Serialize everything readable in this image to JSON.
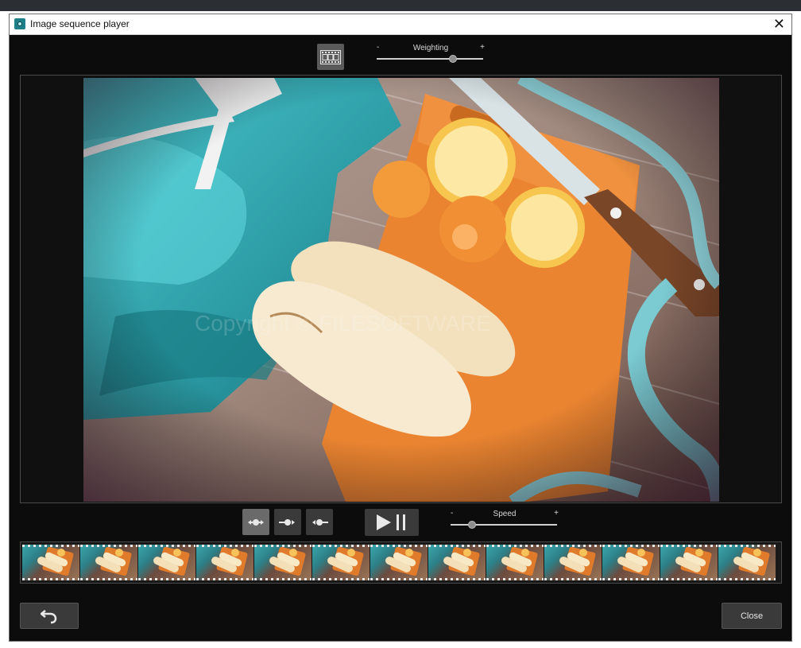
{
  "window": {
    "title": "Image sequence player",
    "close_glyph": "✕"
  },
  "toolbar": {
    "filmstrip_toggle_icon": "filmstrip-icon",
    "weighting": {
      "label": "Weighting",
      "minus": "-",
      "plus": "+",
      "value_fraction": 0.72
    }
  },
  "preview": {
    "watermark": "Copyright © FILESOFTWARE",
    "colors": {
      "cloth": "#37a9b1",
      "board": "#e9822f",
      "wood": "#8a6d5c",
      "lemon": "#f7c85c"
    }
  },
  "controls": {
    "modes": [
      {
        "icon": "fade-mode-icon",
        "active": true
      },
      {
        "icon": "forward-mode-icon",
        "active": false
      },
      {
        "icon": "backward-mode-icon",
        "active": false
      }
    ],
    "play_pause_icon": "play-pause-icon",
    "speed": {
      "label": "Speed",
      "minus": "-",
      "plus": "+",
      "value_fraction": 0.2
    }
  },
  "filmstrip": {
    "frame_count": 13
  },
  "footer": {
    "undo_icon": "undo-icon",
    "close_label": "Close"
  }
}
